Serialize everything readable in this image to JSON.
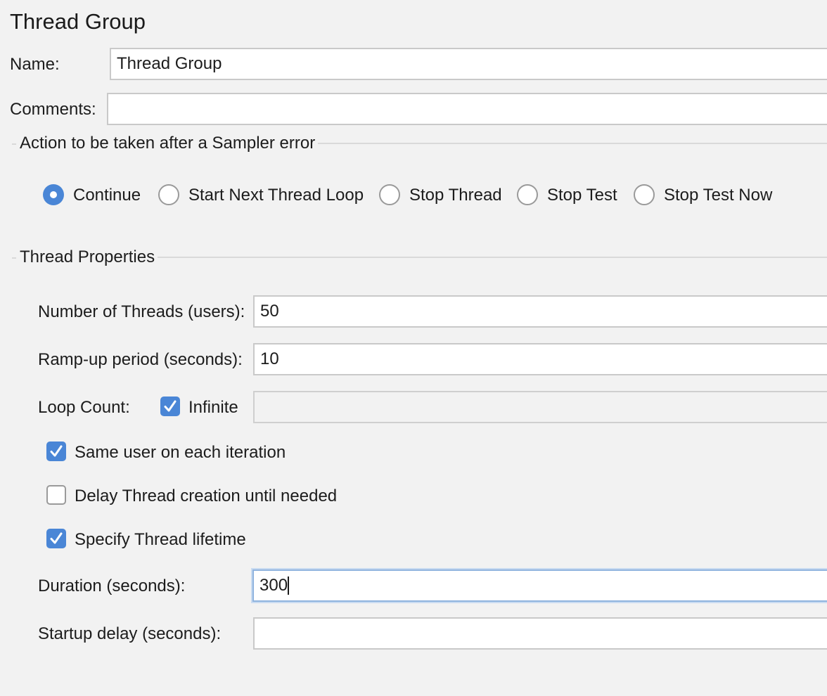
{
  "panel": {
    "title": "Thread Group"
  },
  "name_row": {
    "label": "Name:",
    "value": "Thread Group"
  },
  "comments_row": {
    "label": "Comments:",
    "value": ""
  },
  "sampler_error": {
    "section_title": "Action to be taken after a Sampler error",
    "options": [
      {
        "label": "Continue",
        "selected": true
      },
      {
        "label": "Start Next Thread Loop",
        "selected": false
      },
      {
        "label": "Stop Thread",
        "selected": false
      },
      {
        "label": "Stop Test",
        "selected": false
      },
      {
        "label": "Stop Test Now",
        "selected": false
      }
    ]
  },
  "thread_properties": {
    "section_title": "Thread Properties",
    "num_threads": {
      "label": "Number of Threads (users):",
      "value": "50"
    },
    "ramp_up": {
      "label": "Ramp-up period (seconds):",
      "value": "10"
    },
    "loop_count": {
      "label": "Loop Count:",
      "infinite_label": "Infinite",
      "infinite_checked": true,
      "value": ""
    },
    "same_user": {
      "label": "Same user on each iteration",
      "checked": true
    },
    "delay_creation": {
      "label": "Delay Thread creation until needed",
      "checked": false
    },
    "specify_lifetime": {
      "label": "Specify Thread lifetime",
      "checked": true
    },
    "duration": {
      "label": "Duration (seconds):",
      "value": "300"
    },
    "startup_delay": {
      "label": "Startup delay (seconds):",
      "value": ""
    }
  },
  "colors": {
    "background": "#f2f2f2",
    "accent": "#4a86d6",
    "focus_ring": "#8fb3de",
    "field_border": "#c9c9c9"
  }
}
